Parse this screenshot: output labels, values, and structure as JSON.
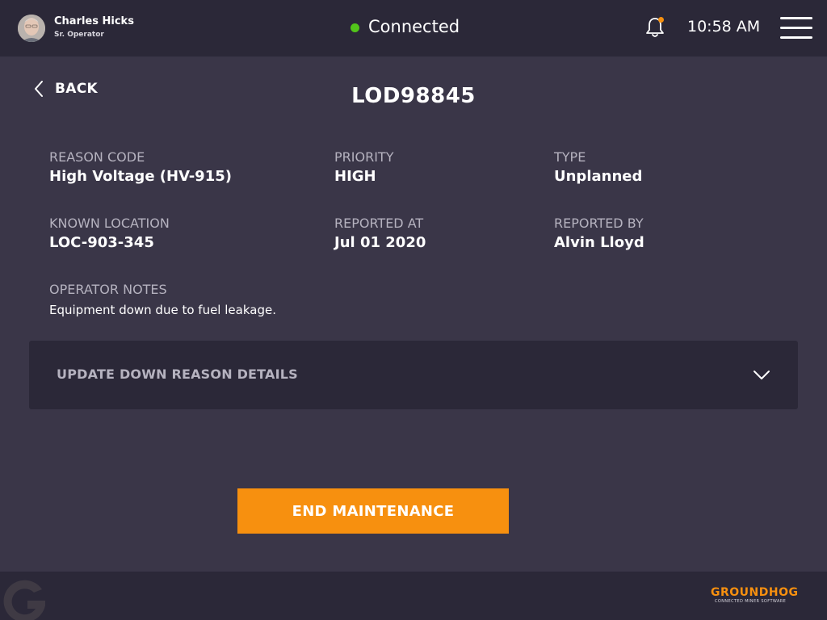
{
  "header": {
    "user_name": "Charles Hicks",
    "user_role": "Sr. Operator",
    "connection_status": "Connected",
    "time": "10:58 AM",
    "icons": {
      "avatar": "user-photo",
      "notifications": "bell-icon",
      "menu": "hamburger-menu-icon"
    }
  },
  "main": {
    "back_label": "BACK",
    "title": "LOD98845",
    "fields": {
      "reason_code": {
        "label": "REASON CODE",
        "value": "High Voltage (HV-915)"
      },
      "priority": {
        "label": "PRIORITY",
        "value": "HIGH"
      },
      "type": {
        "label": "TYPE",
        "value": "Unplanned"
      },
      "known_location": {
        "label": "KNOWN LOCATION",
        "value": "LOC-903-345"
      },
      "reported_at": {
        "label": "REPORTED AT",
        "value": "Jul 01 2020"
      },
      "reported_by": {
        "label": "REPORTED BY",
        "value": "Alvin Lloyd"
      },
      "operator_notes": {
        "label": "OPERATOR NOTES",
        "value": "Equipment down due to fuel leakage."
      }
    },
    "accordion_label": "UPDATE DOWN REASON DETAILS",
    "end_button_label": "END MAINTENANCE"
  },
  "footer": {
    "brand": "GROUNDHOG",
    "brand_tagline": "CONNECTED MINER SOFTWARE"
  },
  "colors": {
    "background": "#3a3648",
    "bar": "#2b2838",
    "accent": "#f7900f",
    "connected": "#52c41a",
    "notification_badge": "#f7900f",
    "label_gray": "#b5b2bf"
  }
}
